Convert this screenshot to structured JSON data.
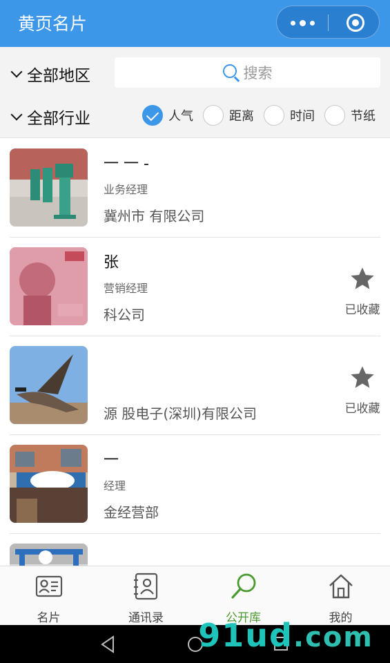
{
  "header": {
    "title": "黄页名片"
  },
  "filters": {
    "region": "全部地区",
    "industry": "全部行业",
    "search_placeholder": "搜索",
    "sort_options": [
      {
        "label": "人气",
        "selected": true
      },
      {
        "label": "距离",
        "selected": false
      },
      {
        "label": "时间",
        "selected": false
      },
      {
        "label": "节纸",
        "selected": false
      }
    ]
  },
  "cards": [
    {
      "name": "一 一 -",
      "role": "业务经理",
      "company": "冀州市          有限公司",
      "favorited": false
    },
    {
      "name": "张",
      "role": "营销经理",
      "company": "                 科公司",
      "favorited": true,
      "favorite_label": "已收藏"
    },
    {
      "name": "",
      "role": "",
      "company": "源    股电子(深圳)有限公司",
      "favorited": true,
      "favorite_label": "已收藏"
    },
    {
      "name": "一",
      "role": "经理",
      "company": "              金经营部",
      "favorited": false
    },
    {
      "name": "",
      "role": "",
      "company": "",
      "favorited": false
    }
  ],
  "tabs": [
    {
      "label": "名片",
      "icon": "business-card-icon",
      "active": false
    },
    {
      "label": "通讯录",
      "icon": "contacts-icon",
      "active": false
    },
    {
      "label": "公开库",
      "icon": "search-icon",
      "active": true
    },
    {
      "label": "我的",
      "icon": "home-icon",
      "active": false
    }
  ],
  "colors": {
    "accent": "#3d97e9",
    "active_tab": "#4a9a2f"
  }
}
